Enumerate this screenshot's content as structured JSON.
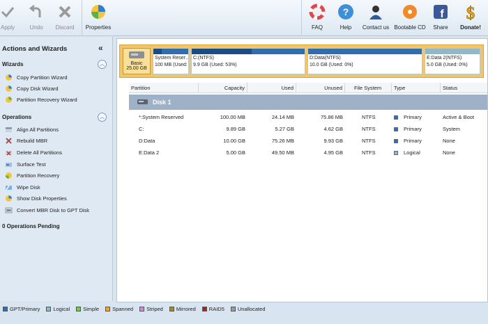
{
  "toolbar": {
    "apply": "Apply",
    "undo": "Undo",
    "discard": "Discard",
    "properties": "Properties",
    "faq": "FAQ",
    "help": "Help",
    "contact": "Contact us",
    "bootable": "Bootable CD",
    "share": "Share",
    "donate": "Donate!"
  },
  "left_panel": {
    "title": "Actions and Wizards",
    "wizards_heading": "Wizards",
    "wizards": [
      {
        "label": "Copy Partition Wizard",
        "icon": "copy-partition-icon"
      },
      {
        "label": "Copy Disk Wizard",
        "icon": "copy-disk-icon"
      },
      {
        "label": "Partition Recovery Wizard",
        "icon": "recovery-wizard-icon"
      }
    ],
    "operations_heading": "Operations",
    "operations": [
      {
        "label": "Align All Partitions",
        "icon": "align-icon"
      },
      {
        "label": "Rebuild MBR",
        "icon": "rebuild-icon"
      },
      {
        "label": "Delete All Partitions",
        "icon": "delete-icon"
      },
      {
        "label": "Surface Test",
        "icon": "surface-test-icon"
      },
      {
        "label": "Partition Recovery",
        "icon": "partition-recovery-icon"
      },
      {
        "label": "Wipe Disk",
        "icon": "wipe-icon"
      },
      {
        "label": "Show Disk Properties",
        "icon": "properties-icon"
      },
      {
        "label": "Convert MBR Disk to GPT Disk",
        "icon": "convert-icon"
      }
    ],
    "pending": "0 Operations Pending"
  },
  "disk_map": {
    "basic_label": "Basic",
    "basic_size": "25.00 GB",
    "parts": [
      {
        "name": "System Reser…",
        "detail": "100 MB (Used: …",
        "used_fraction": 0.24
      },
      {
        "name": "C:(NTFS)",
        "detail": "9.9 GB (Used: 53%)",
        "used_fraction": 0.53
      },
      {
        "name": "D:Data(NTFS)",
        "detail": "10.0 GB (Used: 0%)",
        "used_fraction": 0.0
      },
      {
        "name": "E:Data 2(NTFS)",
        "detail": "5.0 GB (Used: 0%)",
        "used_fraction": 0.0
      }
    ]
  },
  "table": {
    "headers": [
      "Partition",
      "Capacity",
      "Used",
      "Unused",
      "File System",
      "Type",
      "Status"
    ],
    "disk_label": "Disk 1",
    "rows": [
      {
        "partition": "*:System Reserved",
        "capacity": "100.00 MB",
        "used": "24.14 MB",
        "unused": "75.86 MB",
        "fs": "NTFS",
        "type": "Primary",
        "status": "Active & Boot"
      },
      {
        "partition": "C:",
        "capacity": "9.89 GB",
        "used": "5.27 GB",
        "unused": "4.62 GB",
        "fs": "NTFS",
        "type": "Primary",
        "status": "System"
      },
      {
        "partition": "D:Data",
        "capacity": "10.00 GB",
        "used": "75.26 MB",
        "unused": "9.93 GB",
        "fs": "NTFS",
        "type": "Primary",
        "status": "None"
      },
      {
        "partition": "E:Data 2",
        "capacity": "5.00 GB",
        "used": "49.50 MB",
        "unused": "4.95 GB",
        "fs": "NTFS",
        "type": "Logical",
        "status": "None"
      }
    ]
  },
  "legend": [
    {
      "label": "GPT/Primary",
      "color": "#2f6fb5"
    },
    {
      "label": "Logical",
      "color": "#8fb8c8"
    },
    {
      "label": "Simple",
      "color": "#7fc454"
    },
    {
      "label": "Spanned",
      "color": "#e9a545"
    },
    {
      "label": "Striped",
      "color": "#d28ad6"
    },
    {
      "label": "Mirrored",
      "color": "#9f8c3a"
    },
    {
      "label": "RAID5",
      "color": "#a02828"
    },
    {
      "label": "Unallocated",
      "color": "#9a9a9a"
    }
  ],
  "colors": {
    "primary_type": "#2f6fb5",
    "logical_type": "#8fb8c8",
    "disk_map_bg": "#f1c56a"
  }
}
